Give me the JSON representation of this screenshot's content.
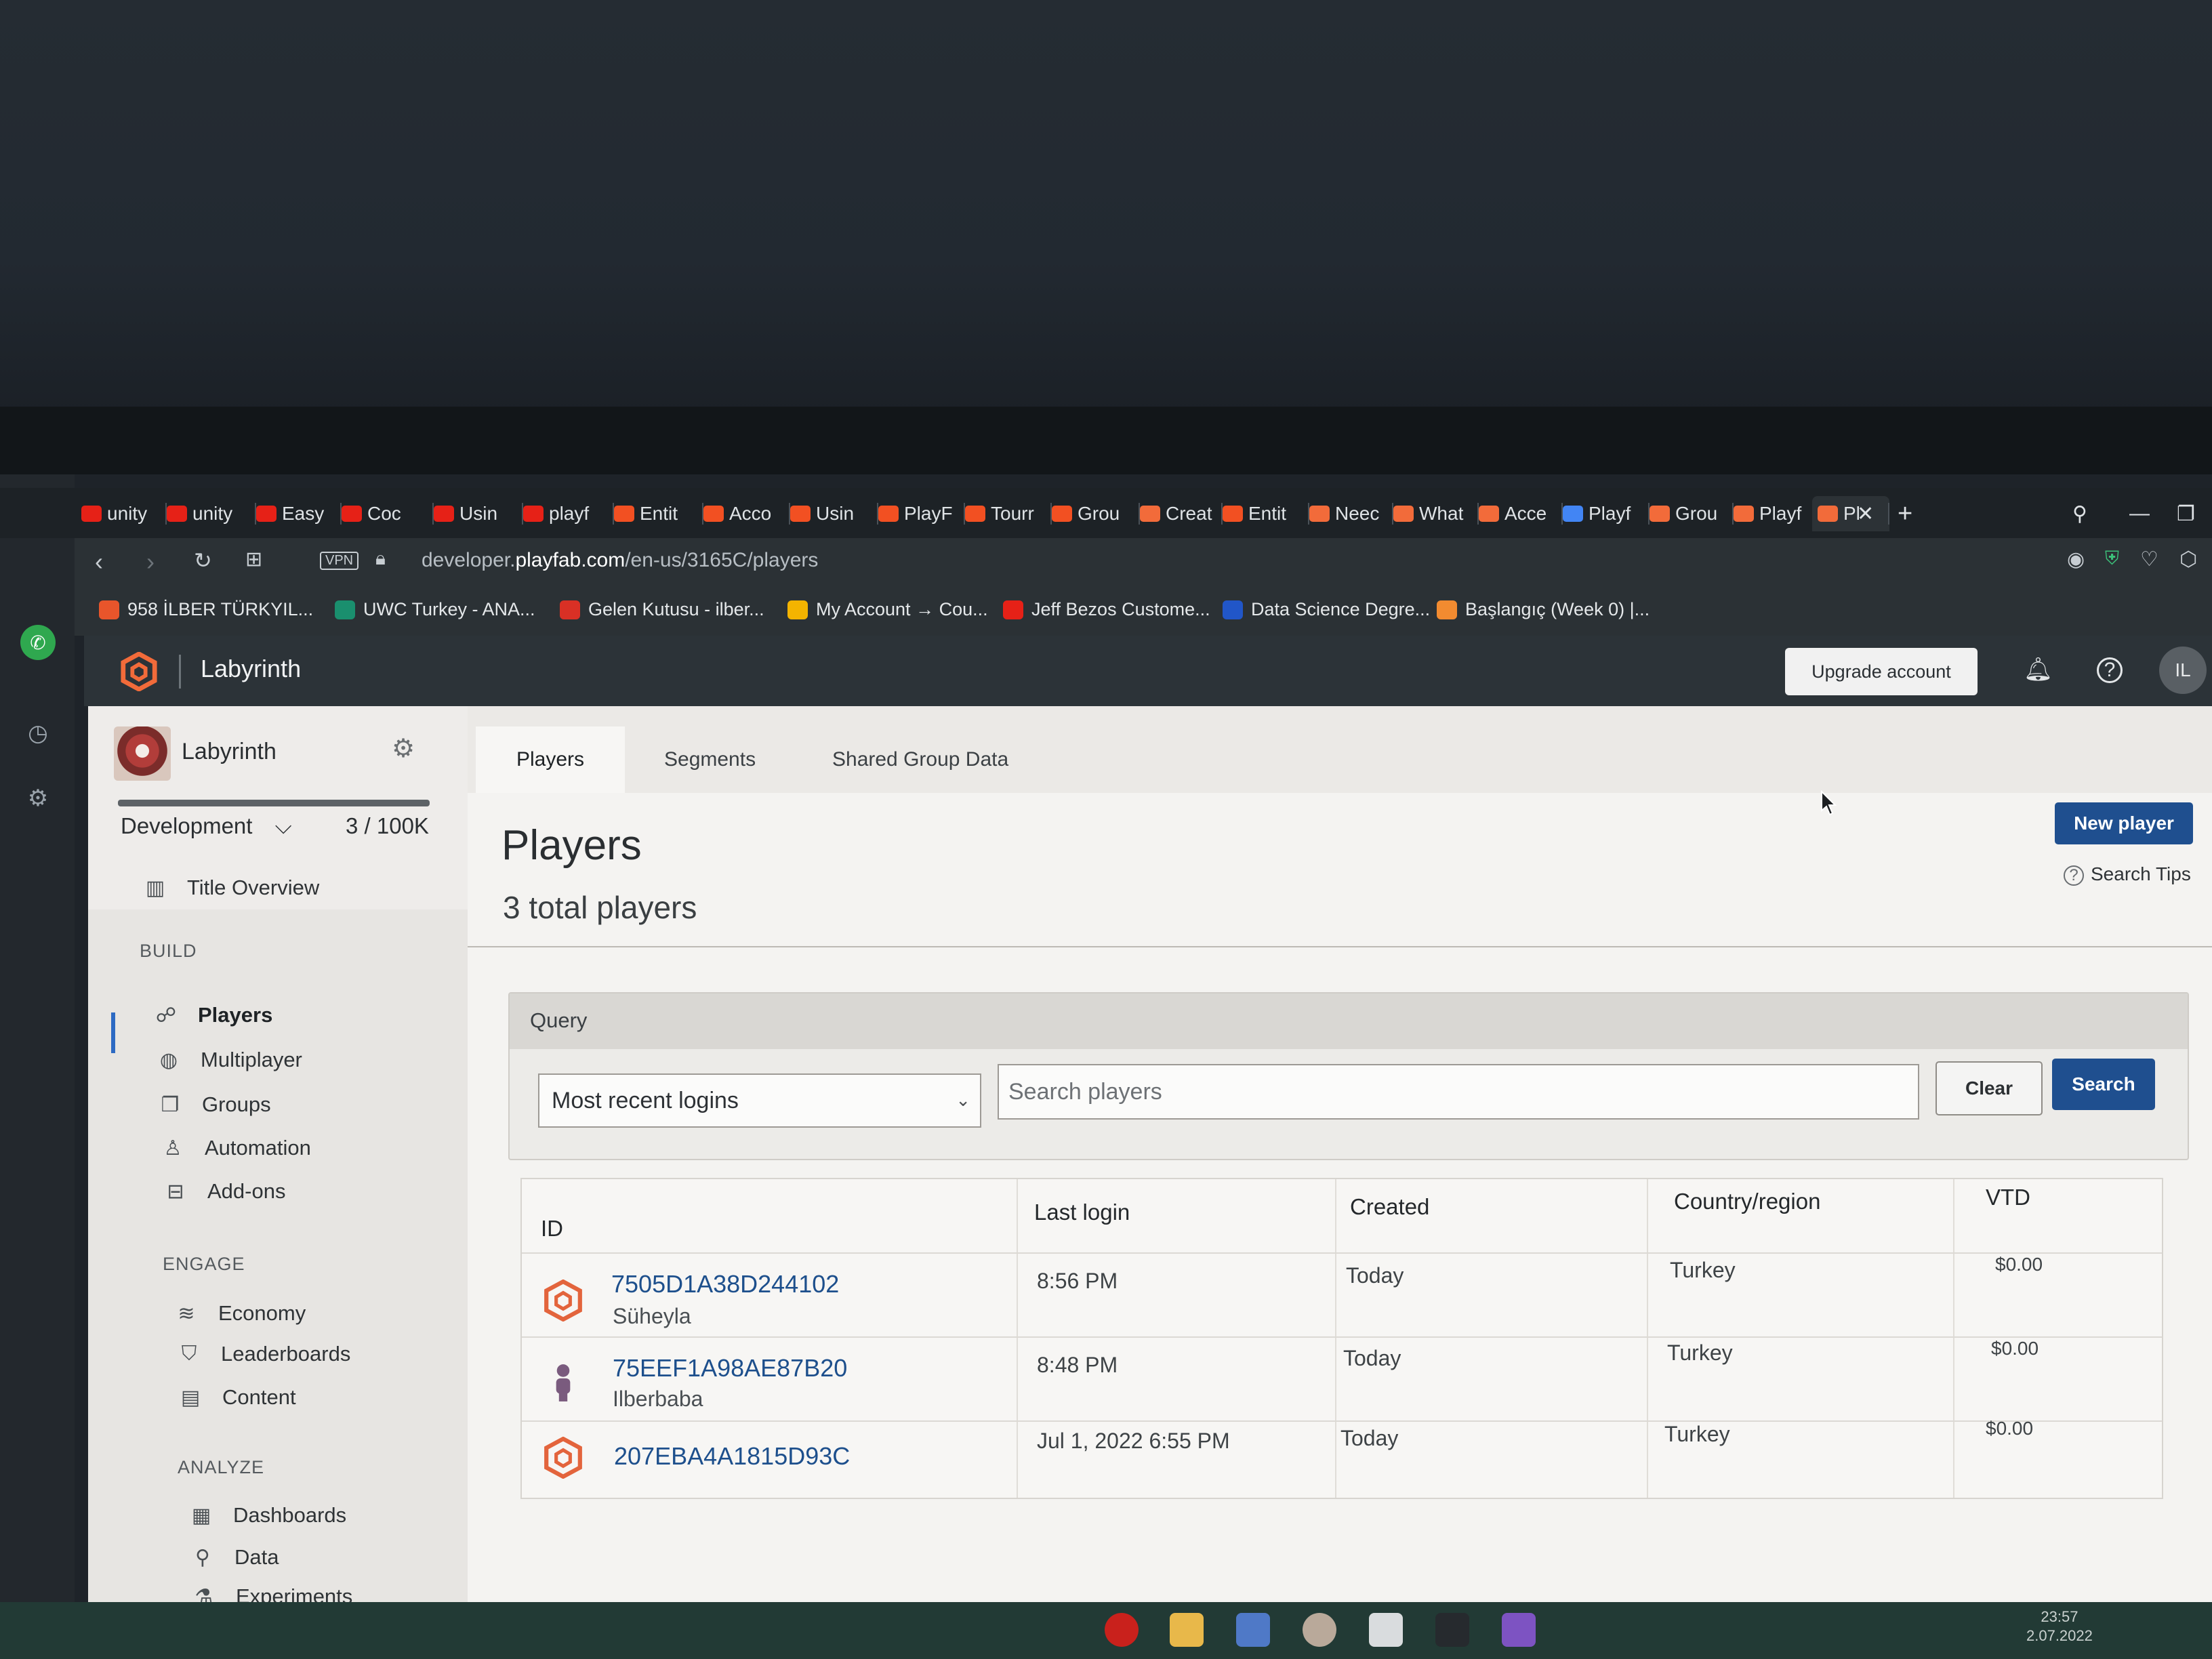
{
  "browser": {
    "tabs": [
      {
        "label": "unity",
        "color": "#e62117"
      },
      {
        "label": "unity",
        "color": "#e62117"
      },
      {
        "label": "Easy",
        "color": "#e62117"
      },
      {
        "label": "Coc",
        "color": "#e62117"
      },
      {
        "label": "Usin",
        "color": "#e62117"
      },
      {
        "label": "playf",
        "color": "#e62117"
      },
      {
        "label": "Entit",
        "color": "#f25022"
      },
      {
        "label": "Acco",
        "color": "#f25022"
      },
      {
        "label": "Usin",
        "color": "#f25022"
      },
      {
        "label": "PlayF",
        "color": "#f25022"
      },
      {
        "label": "Tourr",
        "color": "#f25022"
      },
      {
        "label": "Grou",
        "color": "#f25022"
      },
      {
        "label": "Creat",
        "color": "#f26b3a"
      },
      {
        "label": "Entit",
        "color": "#f25022"
      },
      {
        "label": "Neec",
        "color": "#f26b3a"
      },
      {
        "label": "What",
        "color": "#f26b3a"
      },
      {
        "label": "Acce",
        "color": "#f26b3a"
      },
      {
        "label": "Playf",
        "color": "#4285f4"
      },
      {
        "label": "Grou",
        "color": "#f26b3a"
      },
      {
        "label": "Playf",
        "color": "#f26b3a"
      },
      {
        "label": "Pl",
        "color": "#f26b3a"
      }
    ],
    "vpn_label": "VPN",
    "url_prefix": "developer.",
    "url_domain": "playfab.com",
    "url_path": "/en-us/3165C/players",
    "bookmarks": [
      {
        "label": "958 İLBER TÜRKYIL...",
        "color": "#e8552b"
      },
      {
        "label": "UWC Turkey - ANA...",
        "color": "#1a8f6e"
      },
      {
        "label": "Gelen Kutusu - ilber...",
        "color": "#d93025"
      },
      {
        "label": "My Account → Cou...",
        "color": "#f4b400"
      },
      {
        "label": "Jeff Bezos Custome...",
        "color": "#e62117"
      },
      {
        "label": "Data Science Degre...",
        "color": "#2156c8"
      },
      {
        "label": "Başlangıç (Week 0) |...",
        "color": "#f28b30"
      }
    ]
  },
  "header": {
    "app_title": "Labyrinth",
    "upgrade_label": "Upgrade account",
    "avatar_initials": "IL",
    "brand_color": "#f26b3a"
  },
  "nav": {
    "title_name": "Labyrinth",
    "environment": "Development",
    "player_count": "3 / 100K",
    "title_overview": "Title Overview",
    "sections": {
      "build": "BUILD",
      "engage": "ENGAGE",
      "analyze": "ANALYZE"
    },
    "build_items": [
      "Players",
      "Multiplayer",
      "Groups",
      "Automation",
      "Add-ons"
    ],
    "engage_items": [
      "Economy",
      "Leaderboards",
      "Content"
    ],
    "analyze_items": [
      "Dashboards",
      "Data",
      "Experiments"
    ]
  },
  "main": {
    "tabs": [
      "Players",
      "Segments",
      "Shared Group Data"
    ],
    "title": "Players",
    "subtitle": "3 total players",
    "new_player_label": "New player",
    "search_tips_label": "Search Tips",
    "query": {
      "label": "Query",
      "filter_value": "Most recent logins",
      "search_placeholder": "Search players",
      "clear_label": "Clear",
      "search_label": "Search"
    },
    "table": {
      "columns": [
        "ID",
        "Last login",
        "Created",
        "Country/region",
        "VTD"
      ],
      "rows": [
        {
          "id": "7505D1A38D244102",
          "name": "Süheyla",
          "last_login": "8:56 PM",
          "created": "Today",
          "country": "Turkey",
          "vtd": "$0.00",
          "icon": "playfab-logo-icon"
        },
        {
          "id": "75EEF1A98AE87B20",
          "name": "Ilberbaba",
          "last_login": "8:48 PM",
          "created": "Today",
          "country": "Turkey",
          "vtd": "$0.00",
          "icon": "person-icon"
        },
        {
          "id": "207EBA4A1815D93C",
          "name": "",
          "last_login": "Jul 1, 2022 6:55 PM",
          "created": "Today",
          "country": "Turkey",
          "vtd": "$0.00",
          "icon": "playfab-logo-icon"
        }
      ]
    }
  },
  "taskbar": {
    "time": "23:57",
    "date": "2.07.2022"
  }
}
